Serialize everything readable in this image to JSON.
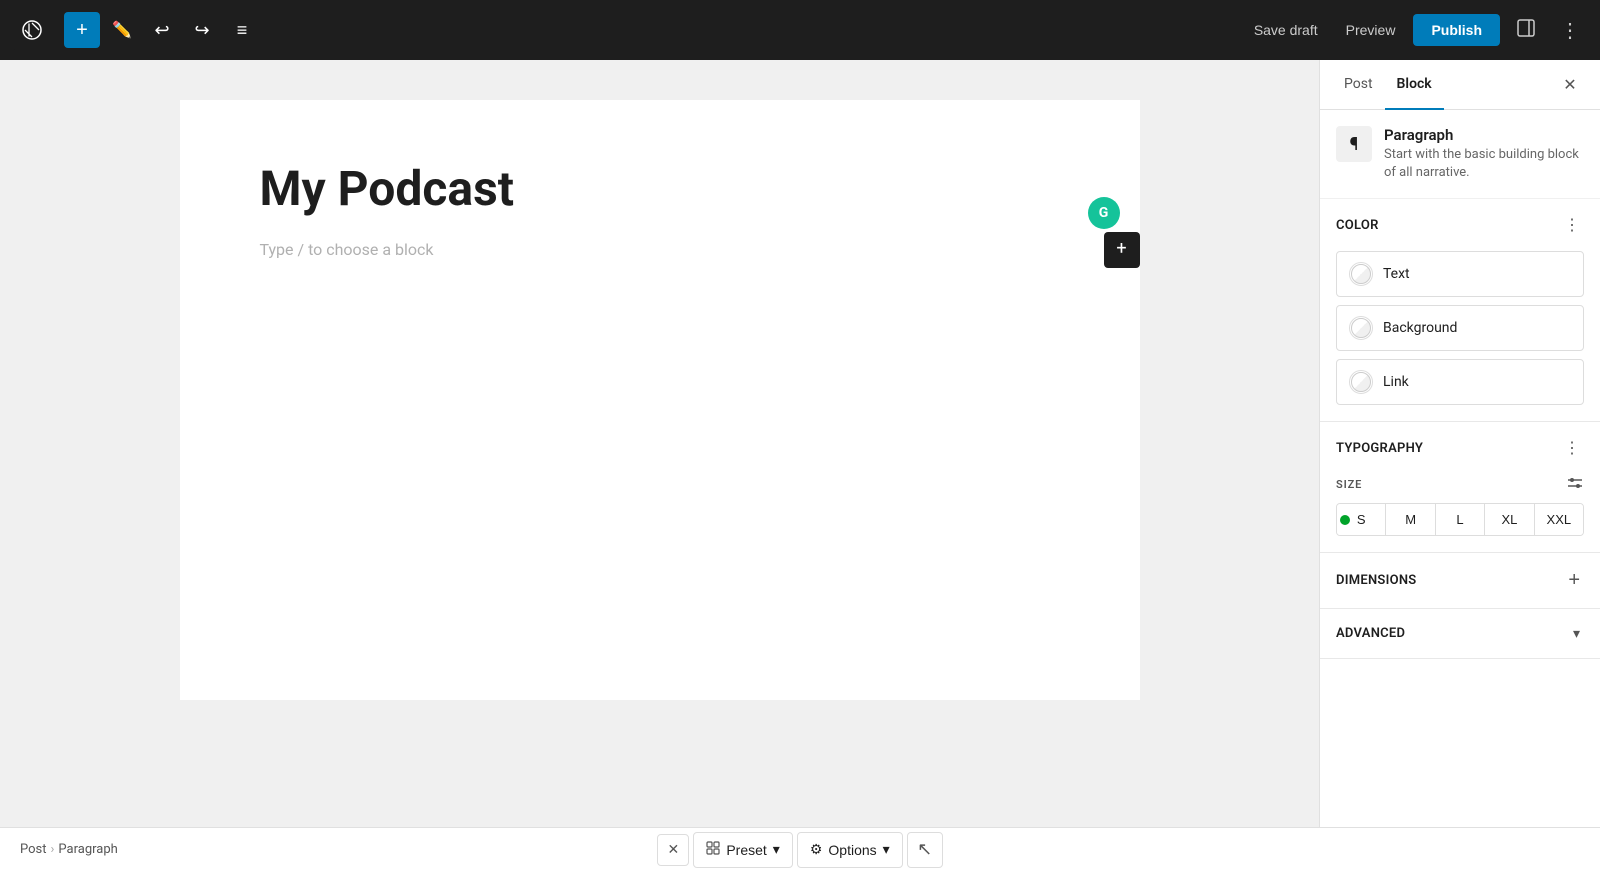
{
  "toolbar": {
    "add_label": "+",
    "undo_label": "↩",
    "redo_label": "↪",
    "menu_label": "☰",
    "save_draft_label": "Save draft",
    "preview_label": "Preview",
    "publish_label": "Publish",
    "sidebar_toggle_label": "⬜",
    "more_label": "⋮"
  },
  "editor": {
    "post_title": "My Podcast",
    "placeholder_text": "Type / to choose a block",
    "add_block_label": "+"
  },
  "sidebar": {
    "tab_post_label": "Post",
    "tab_block_label": "Block",
    "close_label": "✕",
    "block_icon": "¶",
    "block_name": "Paragraph",
    "block_description": "Start with the basic building block of all narrative.",
    "color_section_title": "Color",
    "color_options": [
      {
        "label": "Text"
      },
      {
        "label": "Background"
      },
      {
        "label": "Link"
      }
    ],
    "typography_section_title": "Typography",
    "size_label": "SIZE",
    "size_options": [
      "S",
      "M",
      "L",
      "XL",
      "XXL"
    ],
    "dimensions_section_title": "Dimensions",
    "advanced_section_title": "Advanced"
  },
  "bottom_bar": {
    "close_label": "✕",
    "preset_label": "Preset",
    "options_label": "Options",
    "more_label": "⋯",
    "breadcrumb_post": "Post",
    "breadcrumb_sep": "›",
    "breadcrumb_paragraph": "Paragraph"
  },
  "grammarly": {
    "label": "G"
  }
}
